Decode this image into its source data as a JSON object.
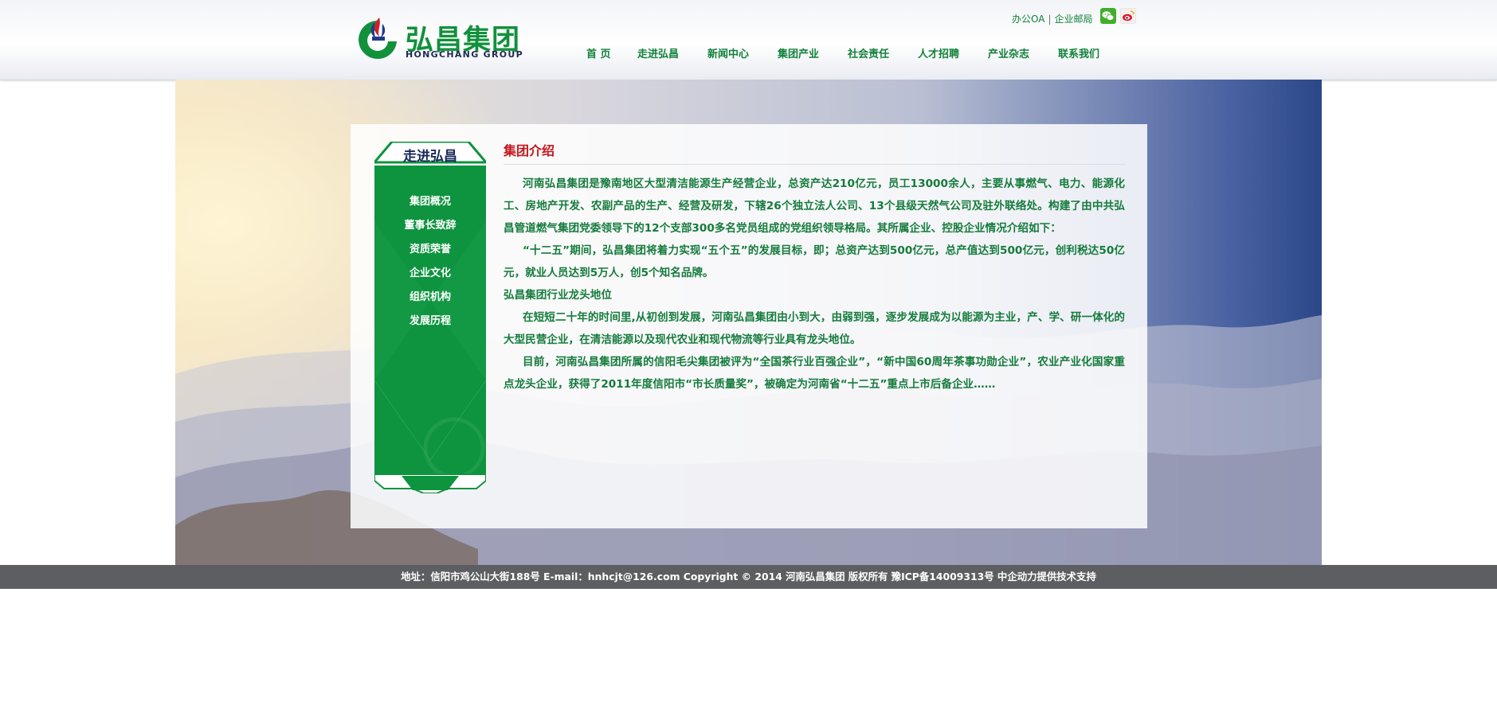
{
  "brand": {
    "name_cn": "弘昌集团",
    "name_en": "HONGCHANG GROUP",
    "color": "#11913b",
    "accent": "#c3161c"
  },
  "toplinks": {
    "oa": "办公OA",
    "separator": "|",
    "mail": "企业邮局",
    "icons": [
      "wechat-icon",
      "weibo-icon"
    ]
  },
  "nav": {
    "items": [
      {
        "label": "首 页"
      },
      {
        "label": "走进弘昌"
      },
      {
        "label": "新闻中心"
      },
      {
        "label": "集团产业"
      },
      {
        "label": "社会责任"
      },
      {
        "label": "人才招聘"
      },
      {
        "label": "产业杂志"
      },
      {
        "label": "联系我们"
      }
    ],
    "color": "#11813a"
  },
  "sidebar": {
    "title": "走进弘昌",
    "items": [
      {
        "label": "集团概况"
      },
      {
        "label": "董事长致辞"
      },
      {
        "label": "资质荣誉"
      },
      {
        "label": "企业文化"
      },
      {
        "label": "组织机构"
      },
      {
        "label": "发展历程"
      }
    ],
    "bg_color": "#0e933f"
  },
  "content": {
    "title": "集团介绍",
    "paragraphs": [
      {
        "text": "河南弘昌集团是豫南地区大型清洁能源生产经营企业，总资产达210亿元，员工13000余人，主要从事燃气、电力、能源化工、房地产开发、农副产品的生产、经营及研发，下辖26个独立法人公司、13个县级天然气公司及驻外联络处。构建了由中共弘昌管道燃气集团党委领导下的12个支部300多名党员组成的党组织领导格局。其所属企业、控股企业情况介绍如下："
      },
      {
        "text": "“十二五”期间，弘昌集团将着力实现“五个五”的发展目标，即；总资产达到500亿元，总产值达到500亿元，创利税达50亿元，就业人员达到5万人，创5个知名品牌。"
      },
      {
        "text": "弘昌集团行业龙头地位"
      },
      {
        "text": "在短短二十年的时间里,从初创到发展，河南弘昌集团由小到大，由弱到强，逐步发展成为以能源为主业，产、学、研一体化的大型民营企业，在清洁能源以及现代农业和现代物流等行业具有龙头地位。"
      },
      {
        "text": "目前，河南弘昌集团所属的信阳毛尖集团被评为“全国茶行业百强企业”，“新中国60周年茶事功勋企业”，农业产业化国家重点龙头企业，获得了2011年度信阳市“市长质量奖”，被确定为河南省“十二五”重点上市后备企业……"
      }
    ]
  },
  "footer": {
    "text": "地址：信阳市鸡公山大街188号 E-mail：hnhcjt@126.com Copyright © 2014 河南弘昌集团 版权所有 豫ICP备14009313号 中企动力提供技术支持"
  }
}
